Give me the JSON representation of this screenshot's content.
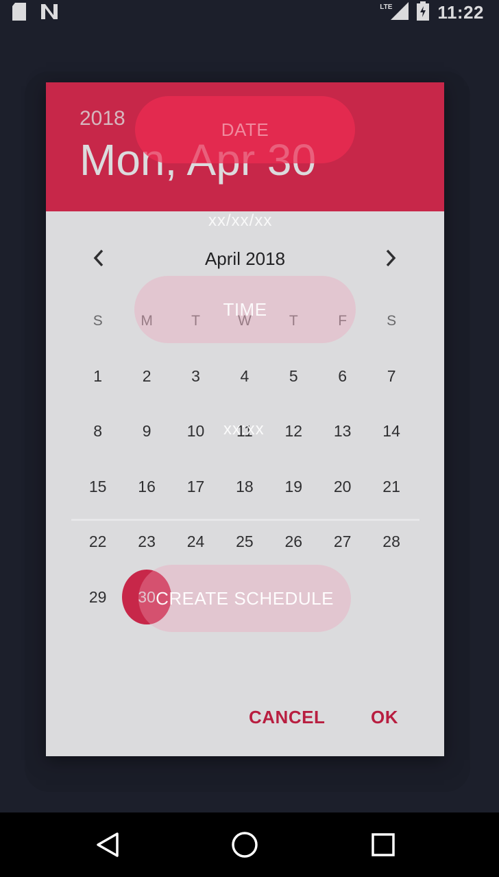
{
  "status_bar": {
    "time": "11:22",
    "network": "LTE",
    "icons": [
      "sd-card-icon",
      "n-notification-icon",
      "signal-icon",
      "battery-icon"
    ]
  },
  "background": {
    "date_label": "DATE",
    "date_value": "xx/xx/xx",
    "time_label": "TIME",
    "time_value": "xx:xx",
    "create_label": "CREATE SCHEDULE"
  },
  "dialog": {
    "year": "2018",
    "selected_date": "Mon, Apr 30",
    "month_title": "April 2018",
    "weekdays": [
      "S",
      "M",
      "T",
      "W",
      "T",
      "F",
      "S"
    ],
    "days": [
      "1",
      "2",
      "3",
      "4",
      "5",
      "6",
      "7",
      "8",
      "9",
      "10",
      "11",
      "12",
      "13",
      "14",
      "15",
      "16",
      "17",
      "18",
      "19",
      "20",
      "21",
      "22",
      "23",
      "24",
      "25",
      "26",
      "27",
      "28",
      "29",
      "30"
    ],
    "selected_day": "30",
    "cancel_label": "CANCEL",
    "ok_label": "OK"
  },
  "colors": {
    "accent": "#e8294f",
    "accent_text": "#d61e45",
    "background": "#1c1f2b"
  },
  "nav_bar": {
    "icons": [
      "back-icon",
      "home-icon",
      "recents-icon"
    ]
  }
}
